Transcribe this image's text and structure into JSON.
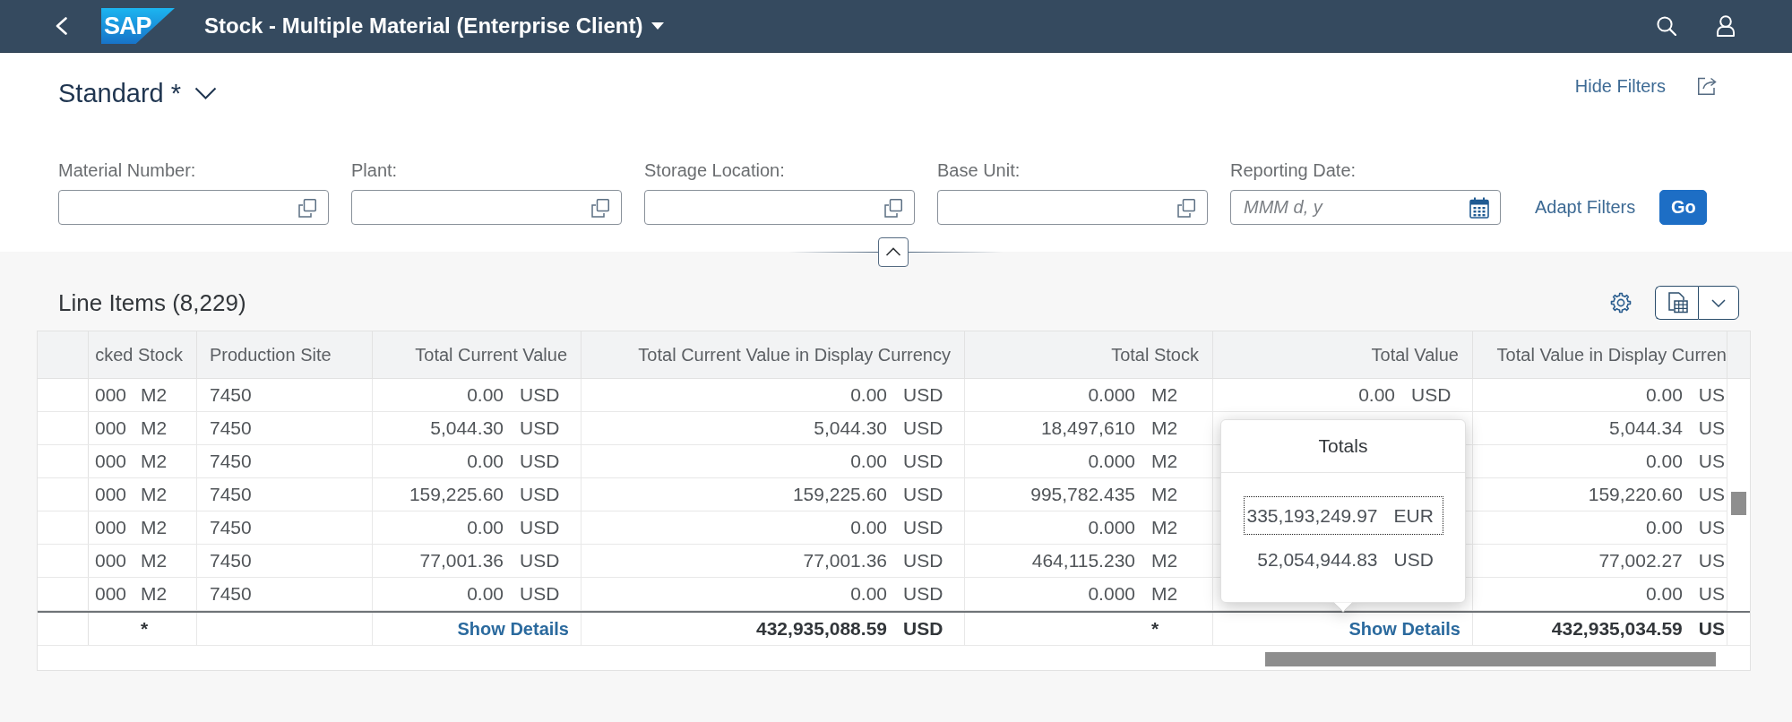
{
  "shell": {
    "logo_text": "SAP",
    "title": "Stock - Multiple Material (Enterprise Client)"
  },
  "variant": {
    "name": "Standard *"
  },
  "filter_bar": {
    "toggle_label": "Hide Filters",
    "fields": [
      {
        "label": "Material Number:",
        "kind": "lookup"
      },
      {
        "label": "Plant:",
        "kind": "lookup"
      },
      {
        "label": "Storage Location:",
        "kind": "lookup"
      },
      {
        "label": "Base Unit:",
        "kind": "lookup"
      },
      {
        "label": "Reporting Date:",
        "kind": "date",
        "placeholder": "MMM d, y"
      }
    ],
    "buttons": [
      {
        "label": "Adapt Filters",
        "kind": "transparent"
      },
      {
        "label": "Go",
        "kind": "emphasized"
      }
    ]
  },
  "table": {
    "title": "Line Items (8,229)",
    "columns": [
      {
        "label": "cked Stock",
        "kind": "amount"
      },
      {
        "label": "Production Site",
        "kind": "text"
      },
      {
        "label": "Total Current Value",
        "kind": "amount"
      },
      {
        "label": "Total Current Value in Display Currency",
        "kind": "amount"
      },
      {
        "label": "Total Stock",
        "kind": "amount"
      },
      {
        "label": "Total Value",
        "kind": "amount"
      },
      {
        "label": "Total Value in Display Curren",
        "kind": "amount"
      }
    ],
    "rows": [
      [
        {
          "kind": "amount",
          "amount": "000",
          "unit": "M2"
        },
        {
          "kind": "text",
          "text": "7450"
        },
        {
          "kind": "amount",
          "amount": "0.00",
          "unit": "USD"
        },
        {
          "kind": "amount",
          "amount": "0.00",
          "unit": "USD"
        },
        {
          "kind": "amount",
          "amount": "0.000",
          "unit": "M2"
        },
        {
          "kind": "amount",
          "amount": "0.00",
          "unit": "USD"
        },
        {
          "kind": "amount",
          "amount": "0.00",
          "unit": "US"
        }
      ],
      [
        {
          "kind": "amount",
          "amount": "000",
          "unit": "M2"
        },
        {
          "kind": "text",
          "text": "7450"
        },
        {
          "kind": "amount",
          "amount": "5,044.30",
          "unit": "USD"
        },
        {
          "kind": "amount",
          "amount": "5,044.30",
          "unit": "USD"
        },
        {
          "kind": "amount",
          "amount": "18,497,610",
          "unit": "M2"
        },
        null,
        {
          "kind": "amount",
          "amount": "5,044.34",
          "unit": "US"
        }
      ],
      [
        {
          "kind": "amount",
          "amount": "000",
          "unit": "M2"
        },
        {
          "kind": "text",
          "text": "7450"
        },
        {
          "kind": "amount",
          "amount": "0.00",
          "unit": "USD"
        },
        {
          "kind": "amount",
          "amount": "0.00",
          "unit": "USD"
        },
        {
          "kind": "amount",
          "amount": "0.000",
          "unit": "M2"
        },
        null,
        {
          "kind": "amount",
          "amount": "0.00",
          "unit": "US"
        }
      ],
      [
        {
          "kind": "amount",
          "amount": "000",
          "unit": "M2"
        },
        {
          "kind": "text",
          "text": "7450"
        },
        {
          "kind": "amount",
          "amount": "159,225.60",
          "unit": "USD"
        },
        {
          "kind": "amount",
          "amount": "159,225.60",
          "unit": "USD"
        },
        {
          "kind": "amount",
          "amount": "995,782.435",
          "unit": "M2"
        },
        null,
        {
          "kind": "amount",
          "amount": "159,220.60",
          "unit": "US"
        }
      ],
      [
        {
          "kind": "amount",
          "amount": "000",
          "unit": "M2"
        },
        {
          "kind": "text",
          "text": "7450"
        },
        {
          "kind": "amount",
          "amount": "0.00",
          "unit": "USD"
        },
        {
          "kind": "amount",
          "amount": "0.00",
          "unit": "USD"
        },
        {
          "kind": "amount",
          "amount": "0.000",
          "unit": "M2"
        },
        null,
        {
          "kind": "amount",
          "amount": "0.00",
          "unit": "US"
        }
      ],
      [
        {
          "kind": "amount",
          "amount": "000",
          "unit": "M2"
        },
        {
          "kind": "text",
          "text": "7450"
        },
        {
          "kind": "amount",
          "amount": "77,001.36",
          "unit": "USD"
        },
        {
          "kind": "amount",
          "amount": "77,001.36",
          "unit": "USD"
        },
        {
          "kind": "amount",
          "amount": "464,115.230",
          "unit": "M2"
        },
        null,
        {
          "kind": "amount",
          "amount": "77,002.27",
          "unit": "US"
        }
      ],
      [
        {
          "kind": "amount",
          "amount": "000",
          "unit": "M2"
        },
        {
          "kind": "text",
          "text": "7450"
        },
        {
          "kind": "amount",
          "amount": "0.00",
          "unit": "USD"
        },
        {
          "kind": "amount",
          "amount": "0.00",
          "unit": "USD"
        },
        {
          "kind": "amount",
          "amount": "0.000",
          "unit": "M2"
        },
        null,
        {
          "kind": "amount",
          "amount": "0.00",
          "unit": "US"
        }
      ]
    ],
    "totals": [
      {
        "kind": "amount",
        "unit": "*"
      },
      {
        "kind": "blank"
      },
      {
        "kind": "link",
        "link": "Show Details"
      },
      {
        "kind": "amount",
        "amount": "432,935,088.59",
        "unit": "USD"
      },
      {
        "kind": "amount",
        "unit": "*"
      },
      {
        "kind": "link",
        "link": "Show Details"
      },
      {
        "kind": "amount",
        "amount": "432,935,034.59",
        "unit": "US"
      }
    ],
    "totals_popover": {
      "title": "Totals",
      "entries": [
        {
          "amount": "335,193,249.97",
          "unit": "EUR",
          "focused": true
        },
        {
          "amount": "52,054,944.83",
          "unit": "USD",
          "focused": false
        }
      ]
    }
  }
}
